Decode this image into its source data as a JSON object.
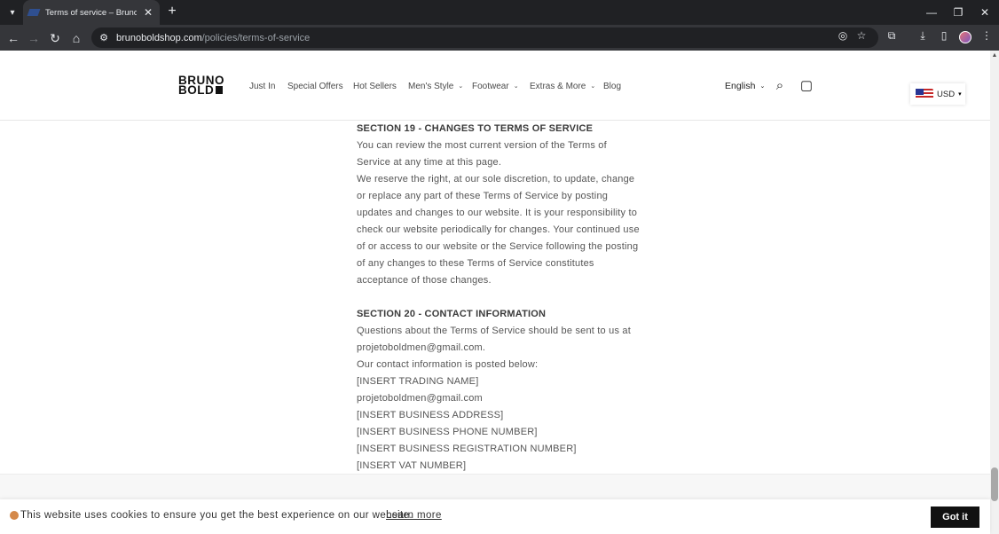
{
  "browser": {
    "tab_title": "Terms of service – Bruno Bold S",
    "url_host": "brunoboldshop.com",
    "url_path": "/policies/terms-of-service",
    "icons": {
      "tab_list": "chevron-down-icon",
      "tab_close": "close-icon",
      "new_tab": "plus-icon",
      "back": "back-arrow-icon",
      "forward": "forward-arrow-icon",
      "reload": "reload-icon",
      "home": "home-icon",
      "site_info": "tune-icon",
      "eye_off": "eye-off-icon",
      "bookmark": "star-icon",
      "extensions": "puzzle-icon",
      "downloads": "download-icon",
      "side_panel": "side-panel-icon",
      "menu": "kebab-menu-icon"
    }
  },
  "header": {
    "logo_line1": "BRUNO",
    "logo_line2": "BOLD",
    "nav": [
      {
        "label": "Just In"
      },
      {
        "label": "Special Offers"
      },
      {
        "label": "Hot Sellers"
      },
      {
        "label": "Men's Style"
      },
      {
        "label": "Footwear"
      },
      {
        "label": "Extras & More"
      },
      {
        "label": "Blog"
      }
    ],
    "language": "English",
    "currency": "USD"
  },
  "content": {
    "section19_heading": "SECTION 19 - CHANGES TO TERMS OF SERVICE",
    "section19_p1": "You can review the most current version of the Terms of Service at any time at this page.",
    "section19_p2": "We reserve the right, at our sole discretion, to update, change or replace any part of these Terms of Service by posting updates and changes to our website. It is your responsibility to check our website periodically for changes. Your continued use of or access to our website or the Service following the posting of any changes to these Terms of Service constitutes acceptance of those changes.",
    "section20_heading": "SECTION 20 - CONTACT INFORMATION",
    "section20_p1": "Questions about the Terms of Service should be sent to us at projetoboldmen@gmail.com.",
    "section20_p2": "Our contact information is posted below:",
    "contact_lines": [
      "[INSERT TRADING NAME]",
      "projetoboldmen@gmail.com",
      "[INSERT BUSINESS ADDRESS]",
      "[INSERT BUSINESS PHONE NUMBER]",
      "[INSERT BUSINESS REGISTRATION NUMBER]",
      "[INSERT VAT NUMBER]"
    ]
  },
  "cookie": {
    "text": "This website uses cookies to ensure you get the best experience on our website.",
    "link": "Learn more",
    "button": "Got it"
  }
}
